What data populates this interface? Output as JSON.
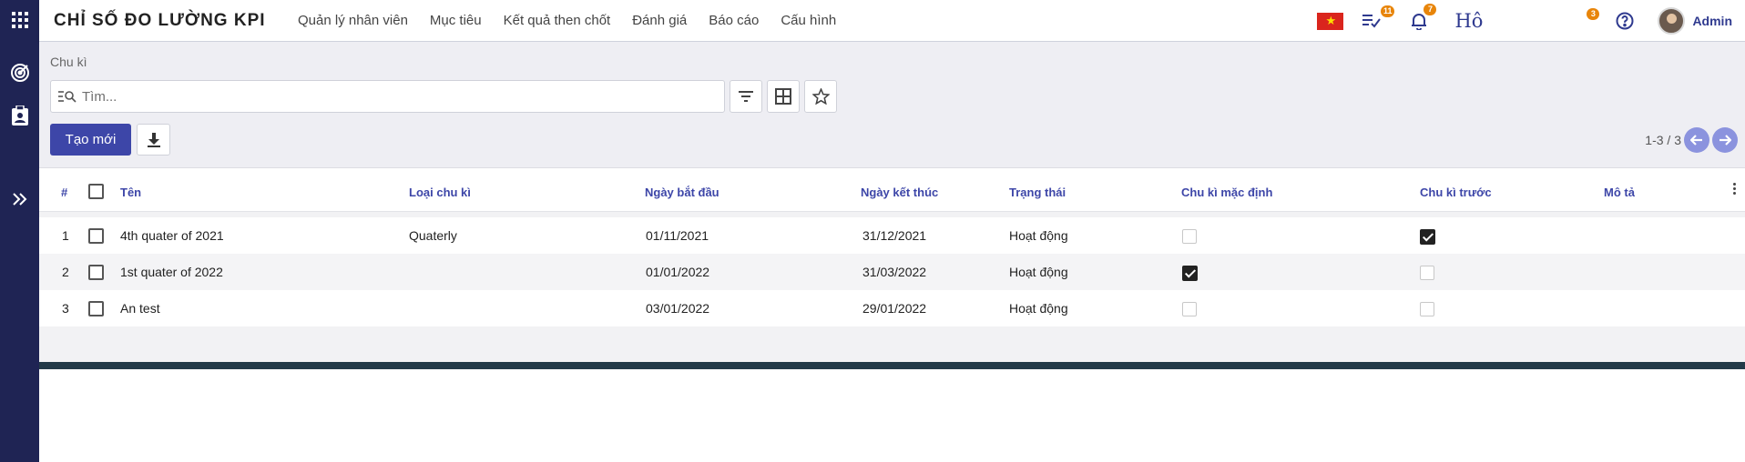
{
  "brand": {
    "title": "CHỈ SỐ ĐO LƯỜNG KPI"
  },
  "menu": [
    {
      "label": "Quản lý nhân viên"
    },
    {
      "label": "Mục tiêu"
    },
    {
      "label": "Kết quả then chốt"
    },
    {
      "label": "Đánh giá"
    },
    {
      "label": "Báo cáo"
    },
    {
      "label": "Cấu hình"
    }
  ],
  "topbar": {
    "tasks_badge": "11",
    "notifications_badge": "7",
    "ho_text": "Hô",
    "extra_badge": "3",
    "user_name": "Admin",
    "flag_star": "★"
  },
  "breadcrumb": "Chu kì",
  "search": {
    "placeholder": "Tìm..."
  },
  "actions": {
    "create_label": "Tạo mới"
  },
  "pager": {
    "text": "1-3 / 3"
  },
  "table": {
    "columns": {
      "index": "#",
      "name": "Tên",
      "type": "Loại chu kì",
      "start": "Ngày bắt đầu",
      "end": "Ngày kết thúc",
      "status": "Trạng thái",
      "default": "Chu kì mặc định",
      "previous": "Chu kì trước",
      "description": "Mô tả"
    },
    "rows": [
      {
        "index": "1",
        "name": "4th quater of 2021",
        "type": "Quaterly",
        "start": "01/11/2021",
        "end": "31/12/2021",
        "status": "Hoạt động",
        "default": false,
        "previous": true
      },
      {
        "index": "2",
        "name": "1st quater of 2022",
        "type": "",
        "start": "01/01/2022",
        "end": "31/03/2022",
        "status": "Hoạt động",
        "default": true,
        "previous": false
      },
      {
        "index": "3",
        "name": "An test",
        "type": "",
        "start": "03/01/2022",
        "end": "29/01/2022",
        "status": "Hoạt động",
        "default": false,
        "previous": false
      }
    ]
  },
  "colors": {
    "rail": "#1f2454",
    "primary": "#3d46a8",
    "badge": "#e8850a",
    "pager": "#8b93de"
  }
}
